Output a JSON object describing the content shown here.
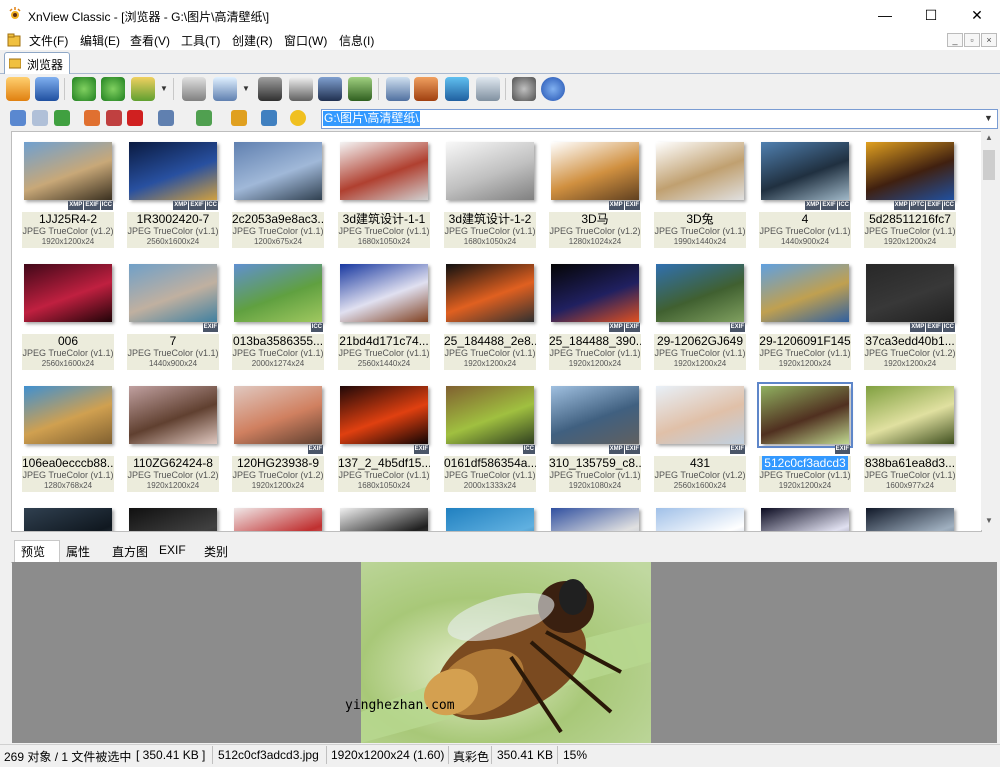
{
  "window": {
    "title": "XnView Classic - [浏览器 - G:\\图片\\高清壁纸\\]",
    "minimize_glyph": "—",
    "maximize_glyph": "☐",
    "close_glyph": "✕"
  },
  "menu": [
    "文件(F)",
    "编辑(E)",
    "查看(V)",
    "工具(T)",
    "创建(R)",
    "窗口(W)",
    "信息(I)"
  ],
  "mdi_buttons": [
    "_",
    "▫",
    "×"
  ],
  "tabs": [
    {
      "label": "浏览器"
    }
  ],
  "address": {
    "value": "G:\\图片\\高清壁纸\\"
  },
  "thumbnails": [
    {
      "name": "1JJ25R4-2",
      "format": "JPEG TrueColor (v1.2)",
      "dims": "1920x1200x24",
      "badges": [
        "XMP",
        "EXIF",
        "ICC"
      ],
      "colors": [
        "#6fa0d0",
        "#c8a878",
        "#3a3020"
      ]
    },
    {
      "name": "1R3002420-7",
      "format": "JPEG TrueColor (v1.1)",
      "dims": "2560x1600x24",
      "badges": [
        "XMP",
        "EXIF",
        "ICC"
      ],
      "colors": [
        "#0a1a40",
        "#2850a0",
        "#d0a040"
      ]
    },
    {
      "name": "2c2053a9e8ac3...",
      "format": "JPEG TrueColor (v1.1)",
      "dims": "1200x675x24",
      "badges": [],
      "colors": [
        "#6080b0",
        "#a0b8d8",
        "#304050"
      ]
    },
    {
      "name": "3d建筑设计-1-1",
      "format": "JPEG TrueColor (v1.1)",
      "dims": "1680x1050x24",
      "badges": [],
      "colors": [
        "#f4f4f4",
        "#b04030",
        "#d0d0d0"
      ]
    },
    {
      "name": "3d建筑设计-1-2",
      "format": "JPEG TrueColor (v1.1)",
      "dims": "1680x1050x24",
      "badges": [],
      "colors": [
        "#f8f8f8",
        "#c0c0c0",
        "#808080"
      ]
    },
    {
      "name": "3D马",
      "format": "JPEG TrueColor (v1.2)",
      "dims": "1280x1024x24",
      "badges": [
        "XMP",
        "EXIF"
      ],
      "colors": [
        "#ffffff",
        "#d09040",
        "#604020"
      ]
    },
    {
      "name": "3D兔",
      "format": "JPEG TrueColor (v1.1)",
      "dims": "1990x1440x24",
      "badges": [],
      "colors": [
        "#ffffff",
        "#c0a070",
        "#e0e0e0"
      ]
    },
    {
      "name": "4",
      "format": "JPEG TrueColor (v1.1)",
      "dims": "1440x900x24",
      "badges": [
        "XMP",
        "EXIF",
        "ICC"
      ],
      "colors": [
        "#5080b0",
        "#203040",
        "#a0b8c8"
      ]
    },
    {
      "name": "5d28511216fc7",
      "format": "JPEG TrueColor (v1.1)",
      "dims": "1920x1200x24",
      "badges": [
        "XMP",
        "IPTC",
        "EXIF",
        "ICC"
      ],
      "colors": [
        "#e0a020",
        "#402010",
        "#2050a0"
      ]
    },
    {
      "name": "006",
      "format": "JPEG TrueColor (v1.1)",
      "dims": "2560x1600x24",
      "badges": [],
      "colors": [
        "#400818",
        "#c02040",
        "#200408"
      ]
    },
    {
      "name": "7",
      "format": "JPEG TrueColor (v1.1)",
      "dims": "1440x900x24",
      "badges": [
        "EXIF"
      ],
      "colors": [
        "#70a0c8",
        "#c0b0a0",
        "#4080a0"
      ]
    },
    {
      "name": "013ba3586355...",
      "format": "JPEG TrueColor (v1.1)",
      "dims": "2000x1274x24",
      "badges": [
        "ICC"
      ],
      "colors": [
        "#6090d0",
        "#60a040",
        "#a0c860"
      ]
    },
    {
      "name": "21bd4d171c74...",
      "format": "JPEG TrueColor (v1.1)",
      "dims": "2560x1440x24",
      "badges": [],
      "colors": [
        "#1838a0",
        "#e0e0f0",
        "#804020"
      ]
    },
    {
      "name": "25_184488_2e8...",
      "format": "JPEG TrueColor (v1.1)",
      "dims": "1920x1200x24",
      "badges": [],
      "colors": [
        "#101010",
        "#e06020",
        "#303030"
      ]
    },
    {
      "name": "25_184488_390...",
      "format": "JPEG TrueColor (v1.1)",
      "dims": "1920x1200x24",
      "badges": [
        "XMP",
        "EXIF"
      ],
      "colors": [
        "#050505",
        "#202060",
        "#e05020"
      ]
    },
    {
      "name": "29-12062GJ649",
      "format": "JPEG TrueColor (v1.1)",
      "dims": "1920x1200x24",
      "badges": [
        "EXIF"
      ],
      "colors": [
        "#3070b0",
        "#406030",
        "#80a060"
      ]
    },
    {
      "name": "29-1206091F145",
      "format": "JPEG TrueColor (v1.1)",
      "dims": "1920x1200x24",
      "badges": [],
      "colors": [
        "#60a0e0",
        "#c0a050",
        "#3060a0"
      ]
    },
    {
      "name": "37ca3edd40b1...",
      "format": "JPEG TrueColor (v1.2)",
      "dims": "1920x1200x24",
      "badges": [
        "XMP",
        "EXIF",
        "ICC"
      ],
      "colors": [
        "#282828",
        "#383838",
        "#202020"
      ]
    },
    {
      "name": "106ea0ecccb88...",
      "format": "JPEG TrueColor (v1.1)",
      "dims": "1280x768x24",
      "badges": [],
      "colors": [
        "#4090d0",
        "#d0a050",
        "#806030"
      ]
    },
    {
      "name": "110ZG62424-8",
      "format": "JPEG TrueColor (v1.2)",
      "dims": "1920x1200x24",
      "badges": [],
      "colors": [
        "#c0a0a0",
        "#604030",
        "#e0c8c0"
      ]
    },
    {
      "name": "120HG23938-9",
      "format": "JPEG TrueColor (v1.2)",
      "dims": "1920x1200x24",
      "badges": [
        "EXIF"
      ],
      "colors": [
        "#e0c8c0",
        "#d08060",
        "#604030"
      ]
    },
    {
      "name": "137_2_4b5df15...",
      "format": "JPEG TrueColor (v1.1)",
      "dims": "1680x1050x24",
      "badges": [
        "EXIF"
      ],
      "colors": [
        "#200808",
        "#e04010",
        "#100404"
      ]
    },
    {
      "name": "0161df586354a...",
      "format": "JPEG TrueColor (v1.1)",
      "dims": "2000x1333x24",
      "badges": [
        "ICC"
      ],
      "colors": [
        "#806030",
        "#a0c040",
        "#304020"
      ]
    },
    {
      "name": "310_135759_c8...",
      "format": "JPEG TrueColor (v1.1)",
      "dims": "1920x1080x24",
      "badges": [
        "XMP",
        "EXIF"
      ],
      "colors": [
        "#a0c0e0",
        "#406080",
        "#606060"
      ]
    },
    {
      "name": "431",
      "format": "JPEG TrueColor (v1.2)",
      "dims": "2560x1600x24",
      "badges": [
        "EXIF"
      ],
      "colors": [
        "#e8f0f8",
        "#e0c0a8",
        "#c0d0e0"
      ]
    },
    {
      "name": "512c0cf3adcd3",
      "format": "JPEG TrueColor (v1.1)",
      "dims": "1920x1200x24",
      "badges": [
        "EXIF"
      ],
      "colors": [
        "#90b060",
        "#503020",
        "#c0d890"
      ],
      "selected": true
    },
    {
      "name": "838ba61ea8d3...",
      "format": "JPEG TrueColor (v1.1)",
      "dims": "1600x977x24",
      "badges": [],
      "colors": [
        "#80a040",
        "#e0e0a0",
        "#405020"
      ]
    },
    {
      "name": "",
      "format": "",
      "dims": "",
      "badges": [],
      "colors": [
        "#304050",
        "#101820",
        "#607080"
      ]
    },
    {
      "name": "",
      "format": "",
      "dims": "",
      "badges": [],
      "colors": [
        "#101010",
        "#404040",
        "#202020"
      ]
    },
    {
      "name": "",
      "format": "",
      "dims": "",
      "badges": [],
      "colors": [
        "#f0e8e8",
        "#c03030",
        "#e0d0d0"
      ]
    },
    {
      "name": "",
      "format": "",
      "dims": "",
      "badges": [],
      "colors": [
        "#f0f0f0",
        "#202020",
        "#808080"
      ]
    },
    {
      "name": "",
      "format": "",
      "dims": "",
      "badges": [],
      "colors": [
        "#2080c0",
        "#60b0e0",
        "#104060"
      ]
    },
    {
      "name": "",
      "format": "",
      "dims": "",
      "badges": [],
      "colors": [
        "#3050a0",
        "#e0e0e0",
        "#a0b0d0"
      ]
    },
    {
      "name": "",
      "format": "",
      "dims": "",
      "badges": [],
      "colors": [
        "#a0c0e8",
        "#ffffff",
        "#6080b0"
      ]
    },
    {
      "name": "",
      "format": "",
      "dims": "",
      "badges": [],
      "colors": [
        "#0a0a20",
        "#e0e0f0",
        "#202040"
      ]
    },
    {
      "name": "",
      "format": "",
      "dims": "",
      "badges": [],
      "colors": [
        "#101828",
        "#a0b0c0",
        "#304050"
      ]
    }
  ],
  "bottom_tabs": [
    "预览",
    "属性",
    "直方图",
    "EXIF",
    "类别"
  ],
  "preview": {
    "watermark": "yinghezhan.com"
  },
  "status": {
    "objects": "269 对象 / 1 文件被选中",
    "size_sel": "[ 350.41 KB ]",
    "filename": "512c0cf3adcd3.jpg",
    "dims": "1920x1200x24 (1.60)",
    "color": "真彩色",
    "size": "350.41 KB",
    "zoom": "15%"
  },
  "icons": [
    "app-eye-icon",
    "menu-browser-icon",
    "tab-browser-icon",
    "address-folder-icon"
  ]
}
